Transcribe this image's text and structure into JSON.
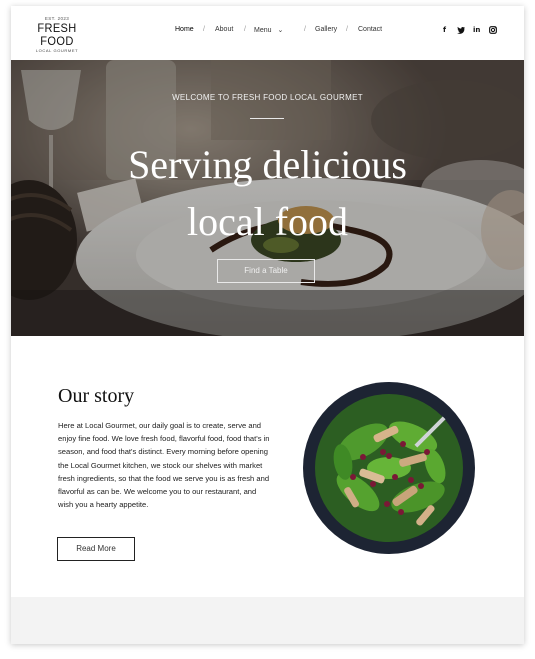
{
  "logo": {
    "est": "EST. 2023",
    "name": "FRESH FOOD",
    "sub": "LOCAL GOURMET"
  },
  "nav": {
    "items": [
      "Home",
      "About",
      "Menu",
      "Gallery",
      "Contact"
    ],
    "separator": "/",
    "active": "Home"
  },
  "social": [
    "facebook-icon",
    "twitter-icon",
    "linkedin-icon",
    "instagram-icon"
  ],
  "hero": {
    "welcome": "WELCOME TO FRESH FOOD LOCAL GOURMET",
    "headline_line1": "Serving delicious",
    "headline_line2": "local food",
    "cta": "Find a Table"
  },
  "story": {
    "title": "Our story",
    "body": "Here at Local Gourmet, our daily goal is to create, serve and enjoy fine food. We love fresh food, flavorful food, food that's in season, and food that's distinct. Every morning before opening the Local Gourmet kitchen, we stock our shelves with market fresh ingredients, so that the food we serve you is as fresh and flavorful as can be. We welcome you to our restaurant, and wish you a hearty appetite.",
    "button": "Read More"
  },
  "colors": {
    "footer_band": "#f3f3f3",
    "hero_overlay": "#000000"
  }
}
